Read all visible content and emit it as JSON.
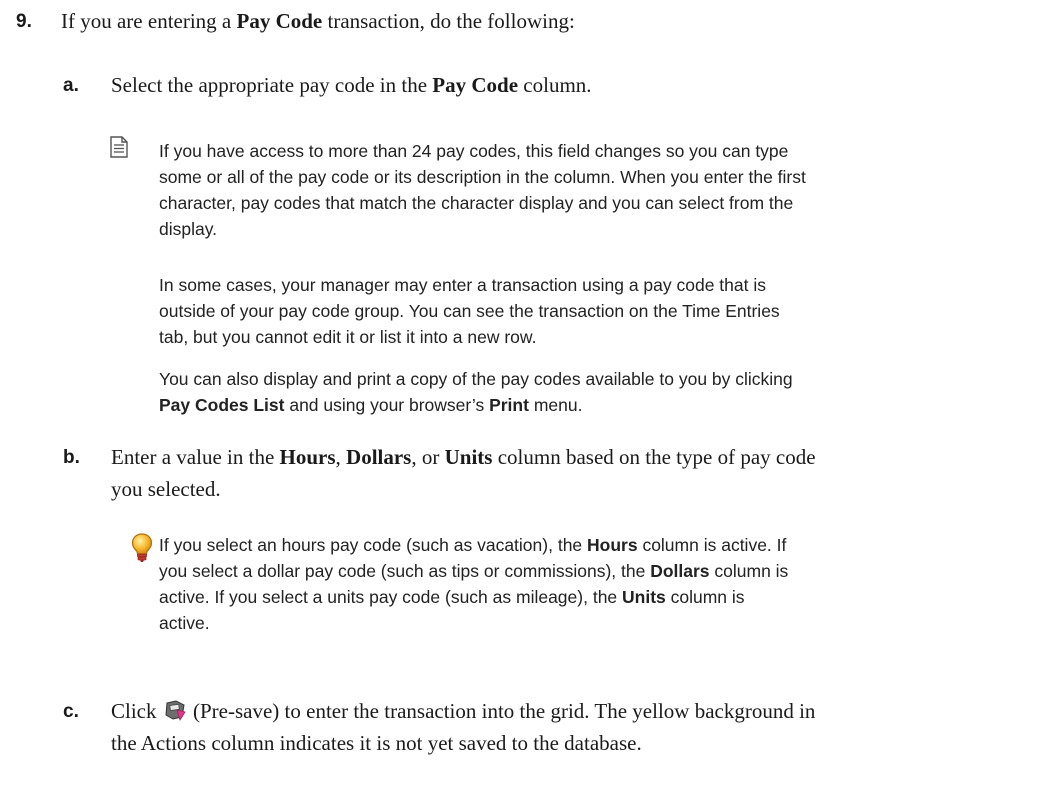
{
  "step9": {
    "number": "9.",
    "pre": "If you are entering a ",
    "bold": "Pay Code",
    "post": " transaction, do the following:"
  },
  "step_a": {
    "letter": "a.",
    "pre": "Select the appropriate pay code in the ",
    "bold": "Pay Code",
    "post": " column."
  },
  "note": {
    "icon": "note-icon",
    "p1_line1": "If you have access to more than 24 pay codes, this field changes so you can type",
    "p1_line2": "some or all of the pay code or its description in the column. When you enter the first",
    "p1_line3": "character, pay codes that match the character display and you can select from the",
    "p1_line4": "display.",
    "p2_line1": "In some cases, your manager may enter a transaction using a pay code that is",
    "p2_line2": "outside of your pay code group. You can see the transaction on the Time Entries",
    "p2_line3": "tab, but you cannot edit it or list it into a new row.",
    "p3_line1": "You can also display and print a copy of the pay codes available to you by clicking",
    "p3_bold1": "Pay Codes List",
    "p3_mid": " and using your browser’s ",
    "p3_bold2": "Print",
    "p3_end": " menu."
  },
  "step_b": {
    "letter": "b.",
    "pre": "Enter a value in the ",
    "bold1": "Hours",
    "sep1": ", ",
    "bold2": "Dollars",
    "sep2": ", or ",
    "bold3": "Units",
    "post": " column based on the type of pay code",
    "line2": "you selected."
  },
  "tip": {
    "icon": "lightbulb-icon",
    "l1_pre": "If you select an hours pay code (such as vacation), the ",
    "l1_bold": "Hours",
    "l1_post": " column is active. If",
    "l2_pre": "you select a dollar pay code (such as tips or commissions), the ",
    "l2_bold": "Dollars",
    "l2_post": " column is",
    "l3_pre": "active. If you select a units pay code (such as mileage), the ",
    "l3_bold": "Units",
    "l3_post": " column is",
    "l4": "active."
  },
  "step_c": {
    "letter": "c.",
    "pre": "Click ",
    "icon": "pre-save-icon",
    "post": " (Pre-save) to enter the transaction into the grid. The yellow background in",
    "line2": "the Actions column indicates it is not yet saved to the database."
  }
}
